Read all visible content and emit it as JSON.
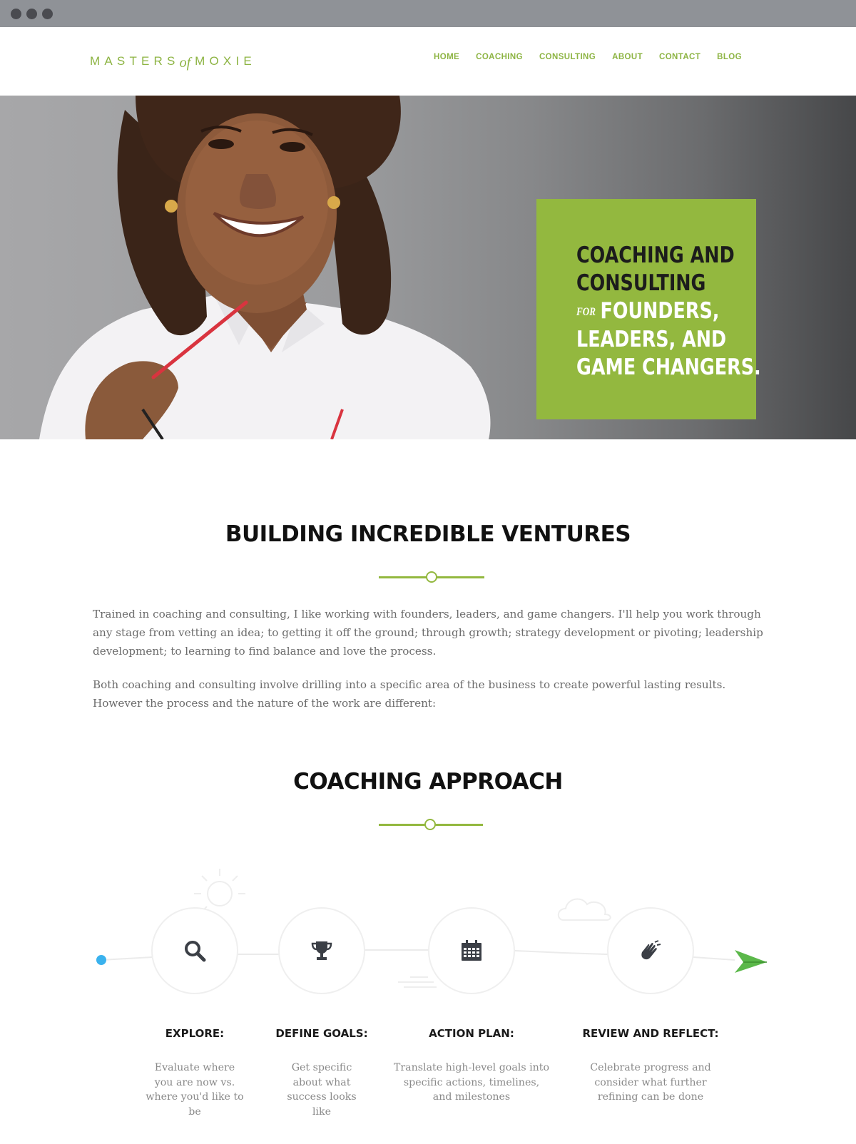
{
  "brand": {
    "logo_left": "MASTERS",
    "logo_of": "of",
    "logo_right": "MOXIE",
    "accent_color": "#93b83f"
  },
  "nav": {
    "items": [
      "HOME",
      "COACHING",
      "CONSULTING",
      "ABOUT",
      "CONTACT",
      "BLOG"
    ]
  },
  "hero": {
    "line1": "COACHING AND",
    "line2": "CONSULTING",
    "for_word": "for",
    "line3": "FOUNDERS,",
    "line4": "LEADERS, AND",
    "line5": "GAME CHANGERS."
  },
  "section_ventures": {
    "title": "BUILDING INCREDIBLE VENTURES",
    "paragraph1": "Trained in coaching and consulting, I like working with founders, leaders, and game changers. I'll help you work through any stage from vetting an idea; to getting it off the ground; through growth; strategy development or pivoting; leadership development; to learning to find balance and love the process.",
    "paragraph2": "Both coaching and consulting involve drilling into a specific area of the business to create powerful lasting results. However the process and the nature of the work are different:"
  },
  "section_approach": {
    "title": "COACHING APPROACH",
    "steps": [
      {
        "icon": "search-icon",
        "title": "EXPLORE:",
        "desc": "Evaluate where you are now vs. where you'd like to be"
      },
      {
        "icon": "trophy-icon",
        "title": "DEFINE GOALS:",
        "desc": "Get specific about what success looks like"
      },
      {
        "icon": "calendar-icon",
        "title": "ACTION PLAN:",
        "desc": "Translate high-level goals into specific actions, timelines, and milestones"
      },
      {
        "icon": "high-five-icon",
        "title": "REVIEW AND REFLECT:",
        "desc": "Celebrate progress and consider what further refining can be done"
      }
    ]
  }
}
